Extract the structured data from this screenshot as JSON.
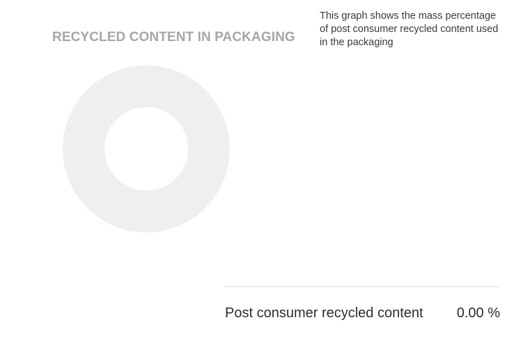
{
  "chart_data": {
    "type": "pie",
    "title": "RECYCLED CONTENT IN PACKAGING",
    "categories": [
      "Post consumer recycled content"
    ],
    "values": [
      0.0
    ],
    "unit": "%",
    "colors": {
      "empty_ring": "#efefef"
    }
  },
  "description": "This graph shows the mass percentage of post consumer recycled content used in the packaging",
  "stats": [
    {
      "label": "Post consumer recycled content",
      "value": "0.00 %"
    }
  ]
}
